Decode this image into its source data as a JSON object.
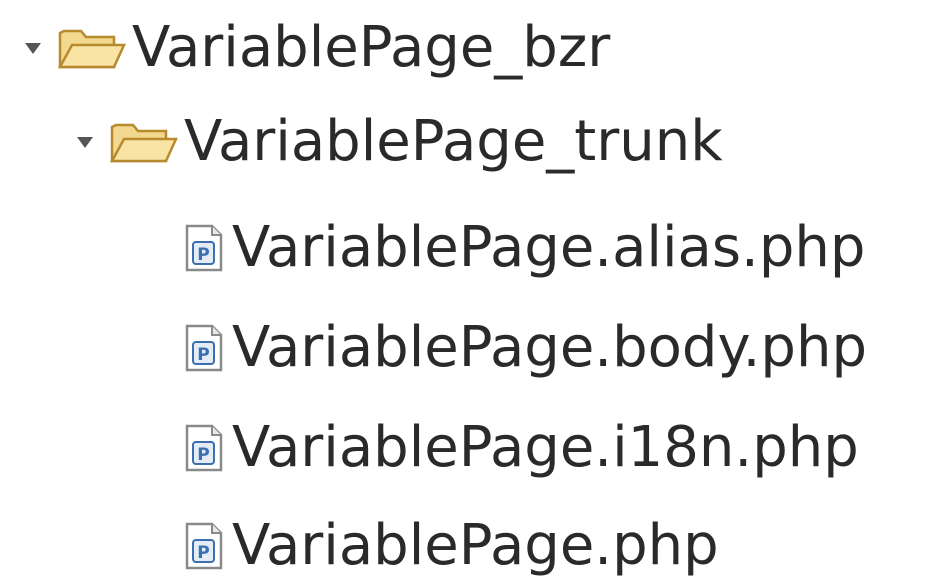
{
  "tree": {
    "root": {
      "label": "VariablePage_bzr",
      "icon": "open-folder-icon",
      "expanded": true,
      "children": [
        {
          "label": "VariablePage_trunk",
          "icon": "open-folder-icon",
          "expanded": true,
          "children": [
            {
              "label": "VariablePage.alias.php",
              "icon": "php-file-icon"
            },
            {
              "label": "VariablePage.body.php",
              "icon": "php-file-icon"
            },
            {
              "label": "VariablePage.i18n.php",
              "icon": "php-file-icon"
            },
            {
              "label": "VariablePage.php",
              "icon": "php-file-icon"
            }
          ]
        }
      ]
    },
    "colors": {
      "text": "#2a2a2a",
      "folder_fill": "#f5d58c",
      "folder_stroke": "#b88a2e",
      "file_stroke": "#8a8a8a",
      "file_badge": "#3a6fb0"
    },
    "file_badge_letter": "P"
  }
}
